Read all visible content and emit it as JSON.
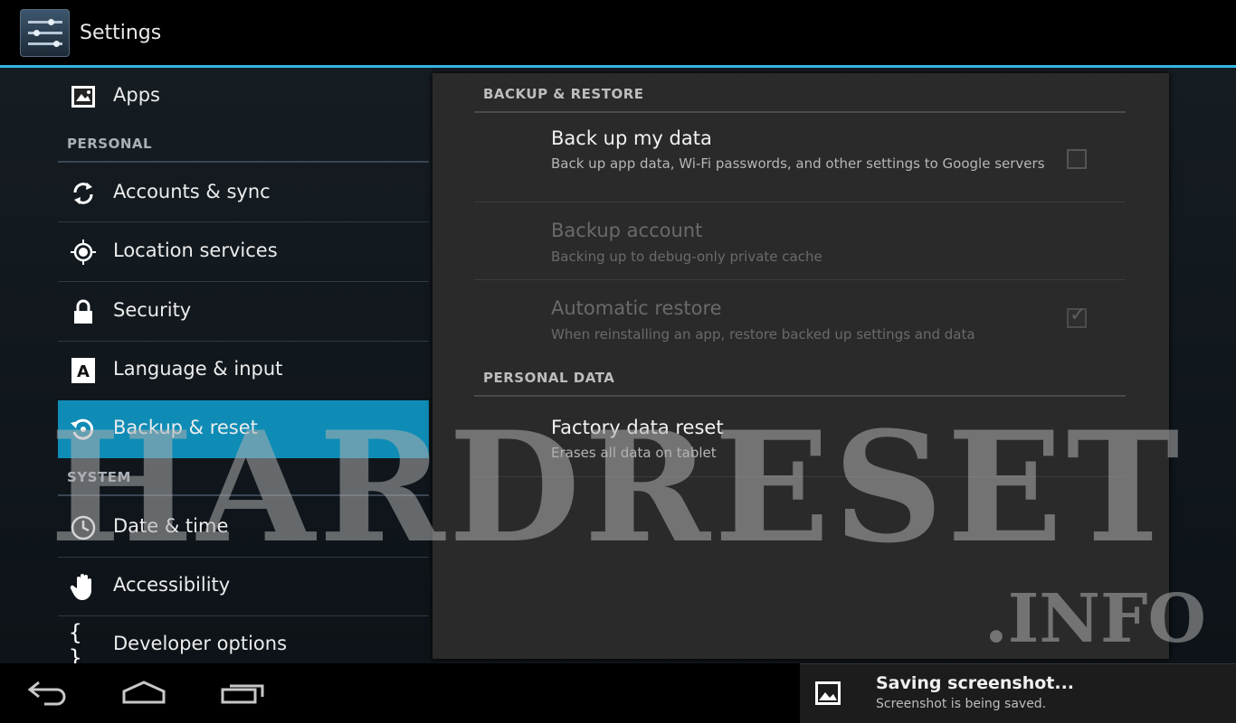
{
  "actionbar": {
    "title": "Settings",
    "icon": "settings-sliders-icon"
  },
  "nav": {
    "items_top": [
      {
        "label": "Apps",
        "icon": "apps-icon"
      }
    ],
    "personal_header": "PERSONAL",
    "personal": [
      {
        "label": "Accounts & sync",
        "icon": "sync-icon"
      },
      {
        "label": "Location services",
        "icon": "location-icon"
      },
      {
        "label": "Security",
        "icon": "lock-icon"
      },
      {
        "label": "Language & input",
        "icon": "language-icon"
      },
      {
        "label": "Backup & reset",
        "icon": "backup-icon",
        "selected": true
      }
    ],
    "system_header": "SYSTEM",
    "system": [
      {
        "label": "Date & time",
        "icon": "clock-icon"
      },
      {
        "label": "Accessibility",
        "icon": "hand-icon"
      },
      {
        "label": "Developer options",
        "icon": "braces-icon"
      }
    ]
  },
  "panel": {
    "backup_header": "BACKUP & RESTORE",
    "backup_my_data": {
      "title": "Back up my data",
      "summary": "Back up app data, Wi-Fi passwords, and other settings to Google servers",
      "checked": false
    },
    "backup_account": {
      "title": "Backup account",
      "summary": "Backing up to debug-only private cache"
    },
    "auto_restore": {
      "title": "Automatic restore",
      "summary": "When reinstalling an app, restore backed up settings and data",
      "checked": true
    },
    "personal_header": "PERSONAL DATA",
    "factory_reset": {
      "title": "Factory data reset",
      "summary": "Erases all data on tablet"
    }
  },
  "watermark": {
    "main": "HARDRESET",
    "suffix": ".INFO"
  },
  "navbar": {
    "back": "back-icon",
    "home": "home-icon",
    "recents": "recents-icon"
  },
  "toast": {
    "title": "Saving screenshot...",
    "subtitle": "Screenshot is being saved."
  },
  "colors": {
    "accent": "#33b5e5",
    "selected": "#0e8cb6",
    "background": "#000000"
  }
}
